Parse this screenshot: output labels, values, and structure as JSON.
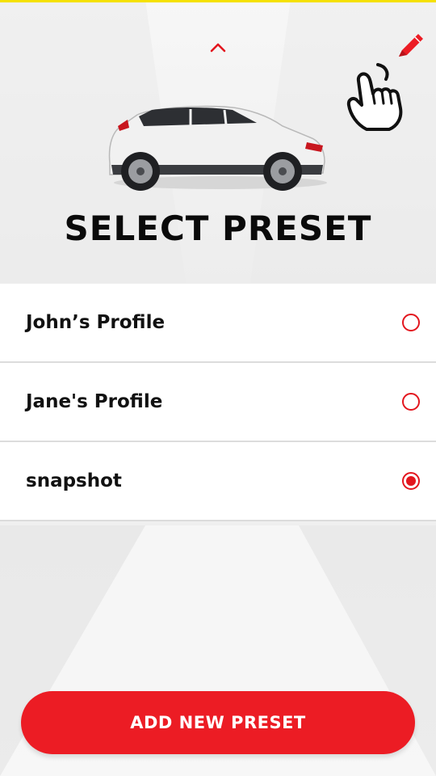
{
  "header": {
    "title": "SELECT PRESET",
    "collapse_icon": "chevron-up-icon",
    "edit_icon": "pencil-icon",
    "hint_icon": "pointing-hand-icon",
    "car_image": "vehicle-image"
  },
  "presets": [
    {
      "label": "John’s Profile",
      "selected": false
    },
    {
      "label": "Jane's Profile",
      "selected": false
    },
    {
      "label": "snapshot",
      "selected": true
    }
  ],
  "footer": {
    "add_button_label": "ADD NEW PRESET"
  },
  "colors": {
    "accent": "#ec1c24",
    "radio": "#e3161e",
    "title": "#0a0a0a",
    "top_strip": "#f5e100"
  }
}
